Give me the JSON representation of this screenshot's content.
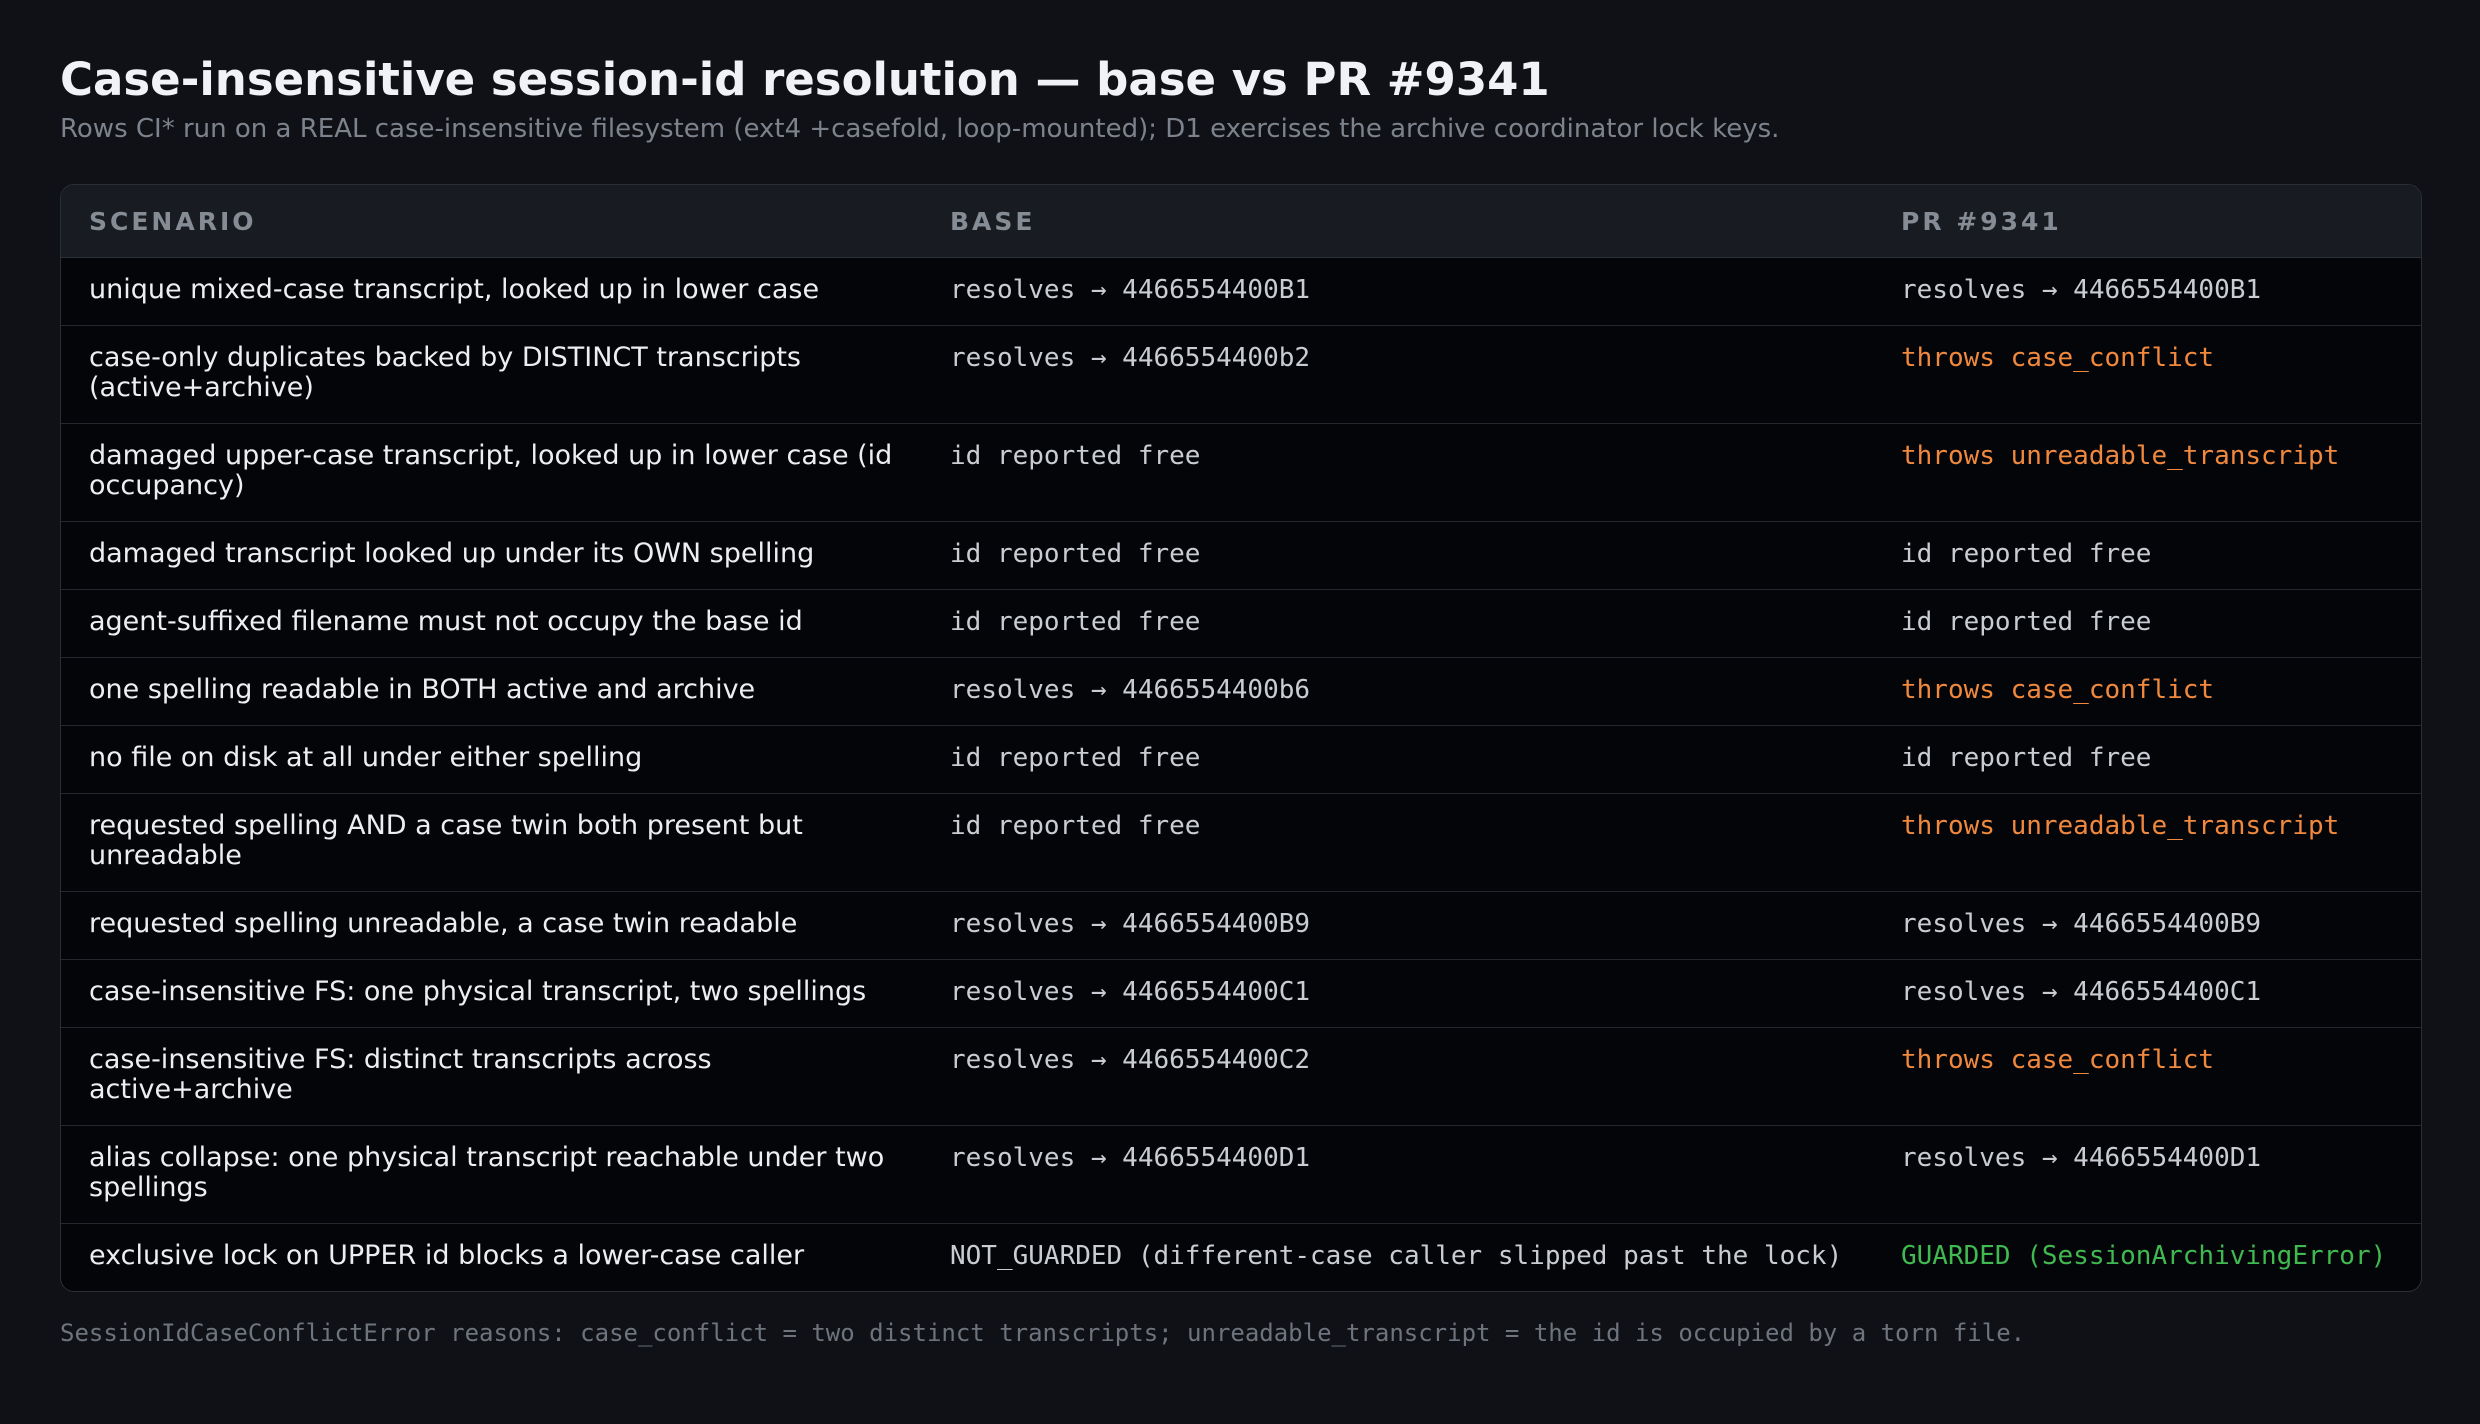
{
  "header": {
    "title": "Case-insensitive session-id resolution — base vs PR #9341",
    "subtitle": "Rows CI* run on a REAL case-insensitive filesystem (ext4 +casefold, loop-mounted); D1 exercises the archive coordinator lock keys."
  },
  "table": {
    "columns": [
      "SCENARIO",
      "BASE",
      "PR #9341"
    ],
    "rows": [
      {
        "scenario": "unique mixed-case transcript, looked up in lower case",
        "base": "resolves → 4466554400B1",
        "pr": "resolves → 4466554400B1",
        "pr_status": "normal"
      },
      {
        "scenario": "case-only duplicates backed by DISTINCT transcripts (active+archive)",
        "base": "resolves → 4466554400b2",
        "pr": "throws case_conflict",
        "pr_status": "throws"
      },
      {
        "scenario": "damaged upper-case transcript, looked up in lower case (id occupancy)",
        "base": "id reported free",
        "pr": "throws unreadable_transcript",
        "pr_status": "throws"
      },
      {
        "scenario": "damaged transcript looked up under its OWN spelling",
        "base": "id reported free",
        "pr": "id reported free",
        "pr_status": "normal"
      },
      {
        "scenario": "agent-suffixed filename must not occupy the base id",
        "base": "id reported free",
        "pr": "id reported free",
        "pr_status": "normal"
      },
      {
        "scenario": "one spelling readable in BOTH active and archive",
        "base": "resolves → 4466554400b6",
        "pr": "throws case_conflict",
        "pr_status": "throws"
      },
      {
        "scenario": "no file on disk at all under either spelling",
        "base": "id reported free",
        "pr": "id reported free",
        "pr_status": "normal"
      },
      {
        "scenario": "requested spelling AND a case twin both present but unreadable",
        "base": "id reported free",
        "pr": "throws unreadable_transcript",
        "pr_status": "throws"
      },
      {
        "scenario": "requested spelling unreadable, a case twin readable",
        "base": "resolves → 4466554400B9",
        "pr": "resolves → 4466554400B9",
        "pr_status": "normal"
      },
      {
        "scenario": "case-insensitive FS: one physical transcript, two spellings",
        "base": "resolves → 4466554400C1",
        "pr": "resolves → 4466554400C1",
        "pr_status": "normal"
      },
      {
        "scenario": "case-insensitive FS: distinct transcripts across active+archive",
        "base": "resolves → 4466554400C2",
        "pr": "throws case_conflict",
        "pr_status": "throws"
      },
      {
        "scenario": "alias collapse: one physical transcript reachable under two spellings",
        "base": "resolves → 4466554400D1",
        "pr": "resolves → 4466554400D1",
        "pr_status": "normal"
      },
      {
        "scenario": "exclusive lock on UPPER id blocks a lower-case caller",
        "base": "NOT_GUARDED (different-case caller slipped past the lock)",
        "pr": "GUARDED (SessionArchivingError)",
        "pr_status": "guarded"
      }
    ]
  },
  "footnote": "SessionIdCaseConflictError reasons: case_conflict = two distinct transcripts; unreadable_transcript = the id is occupied by a torn file.",
  "colors": {
    "background": "#0f1117",
    "throws": "#f0883e",
    "guarded": "#3fb950"
  }
}
